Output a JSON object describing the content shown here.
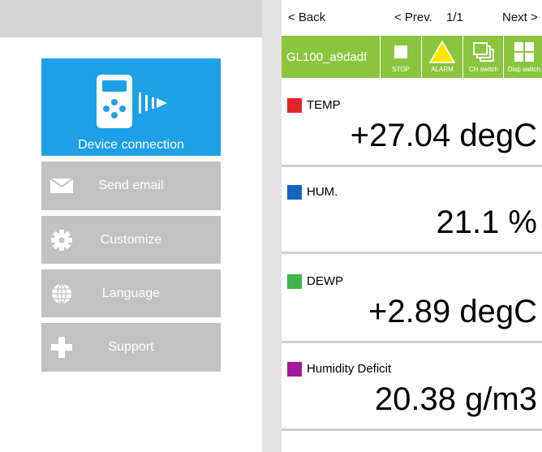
{
  "left_menu": {
    "device_connection": "Device connection",
    "items": [
      {
        "label": "Send email",
        "icon": "mail-icon"
      },
      {
        "label": "Customize",
        "icon": "gear-icon"
      },
      {
        "label": "Language",
        "icon": "globe-icon"
      },
      {
        "label": "Support",
        "icon": "plus-icon"
      }
    ],
    "colors": {
      "device_button": "#1ea0e6",
      "menu_button": "#c2c2c2"
    }
  },
  "nav": {
    "back": "< Back",
    "prev": "< Prev.",
    "page": "1/1",
    "next": "Next >"
  },
  "toolbar": {
    "device_name": "GL100_a9dadf",
    "stop": "STOP",
    "alarm": "ALARM",
    "ch_switch": "CH switch",
    "disp_switch": "Disp switch",
    "color": "#8bc53f"
  },
  "channels": [
    {
      "name": "TEMP",
      "value": "+27.04 degC",
      "color": "#e0262a"
    },
    {
      "name": "HUM.",
      "value": "21.1 %",
      "color": "#1565c0"
    },
    {
      "name": "DEWP",
      "value": "+2.89 degC",
      "color": "#3fb549"
    },
    {
      "name": "Humidity Deficit",
      "value": "20.38 g/m3",
      "color": "#a3199e"
    }
  ]
}
